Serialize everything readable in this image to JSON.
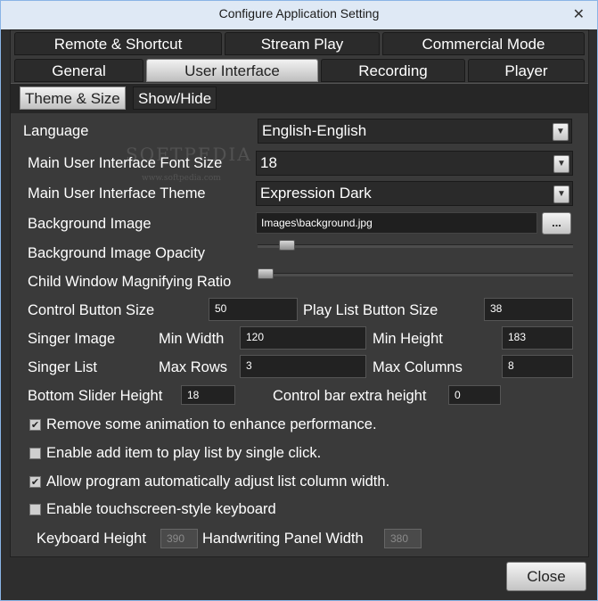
{
  "window": {
    "title": "Configure Application Setting",
    "close_glyph": "✕"
  },
  "tabs_row1": [
    "Remote & Shortcut",
    "Stream Play",
    "Commercial Mode"
  ],
  "tabs_row2": [
    "General",
    "User Interface",
    "Recording",
    "Player"
  ],
  "selected_tab": "User Interface",
  "subtabs": [
    "Theme & Size",
    "Show/Hide"
  ],
  "selected_subtab": "Theme & Size",
  "settings": {
    "language_label": "Language",
    "language_value": "English-English",
    "font_size_label": "Main User Interface Font Size",
    "font_size_value": "18",
    "theme_label": "Main User Interface Theme",
    "theme_value": "Expression Dark",
    "bg_image_label": "Background Image",
    "bg_image_value": "Images\\background.jpg",
    "browse_label": "...",
    "bg_opacity_label": "Background Image Opacity",
    "bg_opacity_level": 0.07,
    "child_mag_label": "Child Window Magnifying Ratio",
    "child_mag_level": 0.0,
    "control_btn_size_label": "Control Button Size",
    "control_btn_size_value": "50",
    "playlist_btn_size_label": "Play List Button Size",
    "playlist_btn_size_value": "38",
    "singer_image_label": "Singer Image",
    "min_width_label": "Min Width",
    "min_width_value": "120",
    "min_height_label": "Min Height",
    "min_height_value": "183",
    "singer_list_label": "Singer List",
    "max_rows_label": "Max Rows",
    "max_rows_value": "3",
    "max_columns_label": "Max Columns",
    "max_columns_value": "8",
    "bottom_slider_label": "Bottom Slider Height",
    "bottom_slider_value": "18",
    "control_bar_label": "Control bar extra height",
    "control_bar_value": "0"
  },
  "checkboxes": [
    {
      "label": "Remove some animation to enhance performance.",
      "checked": true
    },
    {
      "label": "Enable add item to play list by single click.",
      "checked": false
    },
    {
      "label": "Allow program automatically adjust list column width.",
      "checked": true
    },
    {
      "label": "Enable touchscreen-style keyboard",
      "checked": false
    }
  ],
  "keyboard": {
    "height_label": "Keyboard Height",
    "height_value": "390",
    "panel_width_label": "Handwriting Panel Width",
    "panel_width_value": "380"
  },
  "watermark": {
    "text": "SOFTPEDIA",
    "url": "www.softpedia.com"
  },
  "footer": {
    "close_label": "Close"
  },
  "icons": {
    "dropdown": "chevron-down",
    "check": "checkmark",
    "close": "close"
  }
}
